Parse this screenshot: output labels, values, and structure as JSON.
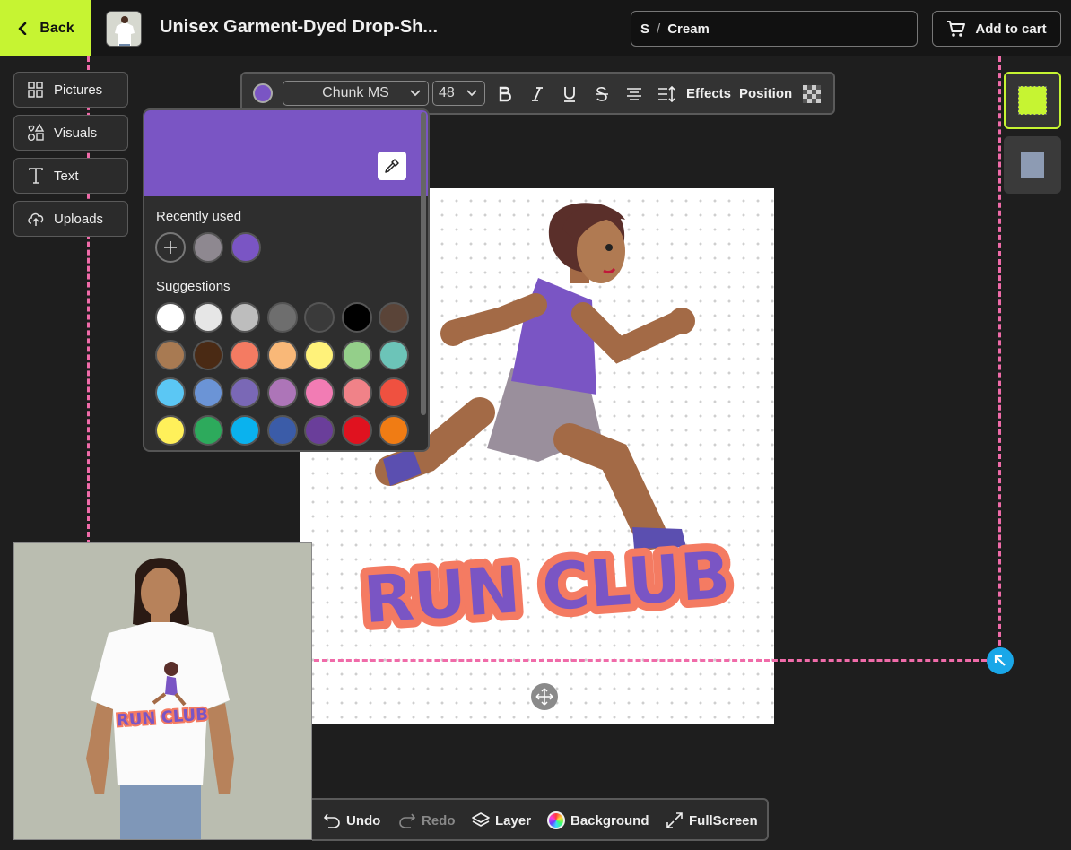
{
  "topbar": {
    "back_label": "Back",
    "product_title": "Unisex Garment-Dyed Drop-Sh...",
    "variant_size": "S",
    "variant_separator": "/",
    "variant_color": "Cream",
    "cart_label": "Add to cart"
  },
  "tools": [
    {
      "label": "Pictures",
      "icon": "pictures-icon"
    },
    {
      "label": "Visuals",
      "icon": "visuals-icon"
    },
    {
      "label": "Text",
      "icon": "text-icon"
    },
    {
      "label": "Uploads",
      "icon": "upload-icon"
    }
  ],
  "text_toolbar": {
    "color": "#7a55c4",
    "font_family_label": "Chunk MS",
    "font_size": "48",
    "effects_label": "Effects",
    "position_label": "Position"
  },
  "color_picker": {
    "current_color": "#7a55c4",
    "recently_used_label": "Recently used",
    "recently_used": [
      "#8e8890",
      "#7a55c4"
    ],
    "suggestions_label": "Suggestions",
    "suggestions": [
      [
        "#ffffff",
        "#e6e6e6",
        "#bdbdbd",
        "#6e6e6e",
        "#3a3a3a",
        "#000000",
        "#5a4438"
      ],
      [
        "#a87a52",
        "#4a2a14",
        "#f47b62",
        "#f9b878",
        "#fff27a",
        "#94cf8a",
        "#6cc4b8"
      ],
      [
        "#5bc7f4",
        "#6b94d6",
        "#7a68b6",
        "#ad75b8",
        "#f27cb4",
        "#f08288",
        "#ef5140"
      ],
      [
        "#fff05a",
        "#2daa5c",
        "#0ab2ee",
        "#3b5ca8",
        "#6a3e9a",
        "#e0121f",
        "#f07c14"
      ]
    ]
  },
  "canvas": {
    "design_text": "RUN CLUB",
    "text_fill": "#7a55c4",
    "text_outline": "#f47b62"
  },
  "bottom_bar": {
    "undo_label": "Undo",
    "redo_label": "Redo",
    "layer_label": "Layer",
    "background_label": "Background",
    "fullscreen_label": "FullScreen"
  },
  "preview": {
    "print_text": "RUN CLUB"
  },
  "colors": {
    "accent": "#c6f432",
    "guide": "#f06ba9",
    "handle": "#1aa7e8"
  }
}
